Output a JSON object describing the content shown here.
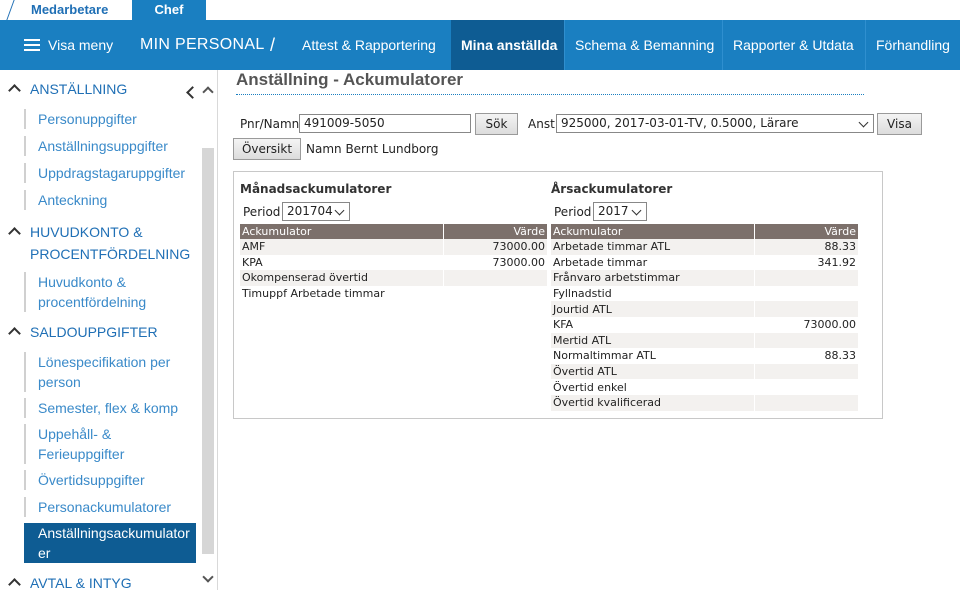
{
  "role_tabs": {
    "medarbetare": "Medarbetare",
    "chef": "Chef"
  },
  "topnav": {
    "menu_label": "Visa meny",
    "section": "MIN PERSONAL",
    "separator": "/",
    "tabs": [
      {
        "label": "Attest & Rapportering"
      },
      {
        "label": "Mina anställda"
      },
      {
        "label": "Schema & Bemanning"
      },
      {
        "label": "Rapporter & Utdata"
      },
      {
        "label": "Förhandling"
      }
    ]
  },
  "sidebar": {
    "sections": [
      {
        "label": "ANSTÄLLNING"
      },
      {
        "label": "HUVUDKONTO & PROCENTFÖRDELNING"
      },
      {
        "label": "SALDOUPPGIFTER"
      },
      {
        "label": "AVTAL & INTYG"
      }
    ],
    "items": [
      {
        "label": "Personuppgifter"
      },
      {
        "label": "Anställningsuppgifter"
      },
      {
        "label": "Uppdragstagaruppgifter"
      },
      {
        "label": "Anteckning"
      },
      {
        "label": "Huvudkonto & procentfördelning"
      },
      {
        "label": "Lönespecifikation per person"
      },
      {
        "label": "Semester, flex & komp"
      },
      {
        "label": "Uppehåll- & Ferieuppgifter"
      },
      {
        "label": "Övertidsuppgifter"
      },
      {
        "label": "Personackumulatorer"
      },
      {
        "label": "Anställningsackumulatorer"
      }
    ]
  },
  "page": {
    "title": "Anställning - Ackumulatorer",
    "pnr_label": "Pnr/Namn",
    "pnr_value": "491009-5050",
    "search_button": "Sök",
    "anst_label": "Anst",
    "anst_value": "925000, 2017-03-01-TV, 0.5000, Lärare",
    "show_button": "Visa",
    "overview_button": "Översikt",
    "name_text": "Namn Bernt Lundborg"
  },
  "monthly": {
    "heading": "Månadsackumulatorer",
    "period_label": "Period",
    "period_value": "201704",
    "col_acc": "Ackumulator",
    "col_val": "Värde",
    "rows": [
      {
        "name": "AMF",
        "value": "73000.00"
      },
      {
        "name": "KPA",
        "value": "73000.00"
      },
      {
        "name": "Okompenserad övertid",
        "value": ""
      },
      {
        "name": "Timuppf Arbetade timmar",
        "value": ""
      }
    ]
  },
  "yearly": {
    "heading": "Årsackumulatorer",
    "period_label": "Period",
    "period_value": "2017",
    "col_acc": "Ackumulator",
    "col_val": "Värde",
    "rows": [
      {
        "name": "Arbetade timmar ATL",
        "value": "88.33"
      },
      {
        "name": "Arbetade timmar",
        "value": "341.92"
      },
      {
        "name": "Frånvaro arbetstimmar",
        "value": ""
      },
      {
        "name": "Fyllnadstid",
        "value": ""
      },
      {
        "name": "Jourtid ATL",
        "value": ""
      },
      {
        "name": "KFA",
        "value": "73000.00"
      },
      {
        "name": "Mertid ATL",
        "value": ""
      },
      {
        "name": "Normaltimmar ATL",
        "value": "88.33"
      },
      {
        "name": "Övertid ATL",
        "value": ""
      },
      {
        "name": "Övertid enkel",
        "value": ""
      },
      {
        "name": "Övertid kvalificerad",
        "value": ""
      }
    ]
  }
}
